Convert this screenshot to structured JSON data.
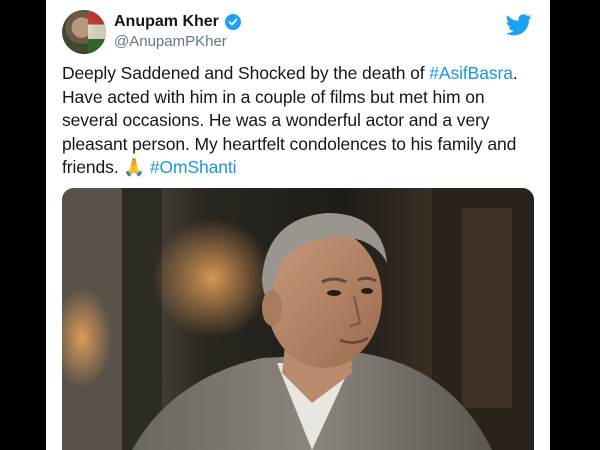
{
  "tweet": {
    "author": {
      "display_name": "Anupam Kher",
      "handle": "@AnupamPKher",
      "verified": true
    },
    "text": {
      "part1": "Deeply Saddened and Shocked by the death of ",
      "hashtag1": "#AsifBasra",
      "part2": ". Have acted with him in a couple of films but met him on several occasions. He was a wonderful actor and a very pleasant person. My heartfelt condolences to his family and friends. ",
      "emoji": "🙏",
      "hashtag2": "#OmShanti"
    },
    "media": {
      "type": "photo"
    }
  },
  "colors": {
    "link": "#1b95e0",
    "twitter_blue": "#1da1f2",
    "text": "#14171a",
    "secondary": "#657786"
  },
  "icons": [
    "twitter-bird-icon",
    "verified-badge-icon"
  ]
}
